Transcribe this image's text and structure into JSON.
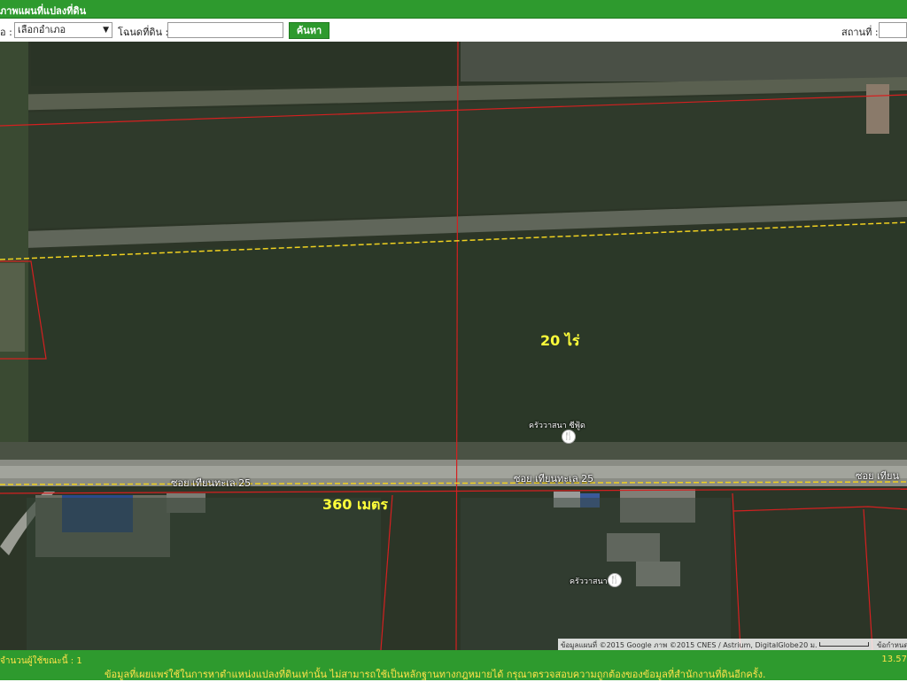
{
  "header": {
    "title": "ภาพแผนที่แปลงที่ดิน"
  },
  "toolbar": {
    "amphoe_label": "อ :",
    "amphoe_select_value": "เลือกอำเภอ",
    "chanote_label": "โฉนดที่ดิน :",
    "chanote_value": "",
    "search_button": "ค้นหา",
    "location_label": "สถานที่ :",
    "location_value": ""
  },
  "map": {
    "area_label": "20 ไร่",
    "distance_label": "360 เมตร",
    "road_labels": [
      "ซอย เทียนทะเล 25",
      "ซอย เทียนทะเล 25",
      "ซอย เทียน"
    ],
    "pois": [
      {
        "name": "ครัววาสนา ซีฟู้ด",
        "icon": "restaurant-icon"
      },
      {
        "name": "ครัววาสนา",
        "icon": "restaurant-icon"
      }
    ],
    "attribution": "ข้อมูลแผนที่ ©2015 Google ภาพ ©2015 CNES / Astrium, DigitalGlobe",
    "scale": "20 ม.",
    "report": "ข้อกำหนด",
    "colors": {
      "parcel_line": "#d42020",
      "boundary_dash": "#f0d020",
      "map_bg": "#2c3527"
    }
  },
  "footer": {
    "user_count": "จำนวนผู้ใช้ขณะนี้ : 1",
    "coordinate": "13.57",
    "disclaimer": "ข้อมูลที่เผยแพร่ใช้ในการหาตำแหน่งแปลงที่ดินเท่านั้น ไม่สามารถใช้เป็นหลักฐานทางกฎหมายได้ กรุณาตรวจสอบความถูกต้องของข้อมูลที่สำนักงานที่ดินอีกครั้ง."
  }
}
